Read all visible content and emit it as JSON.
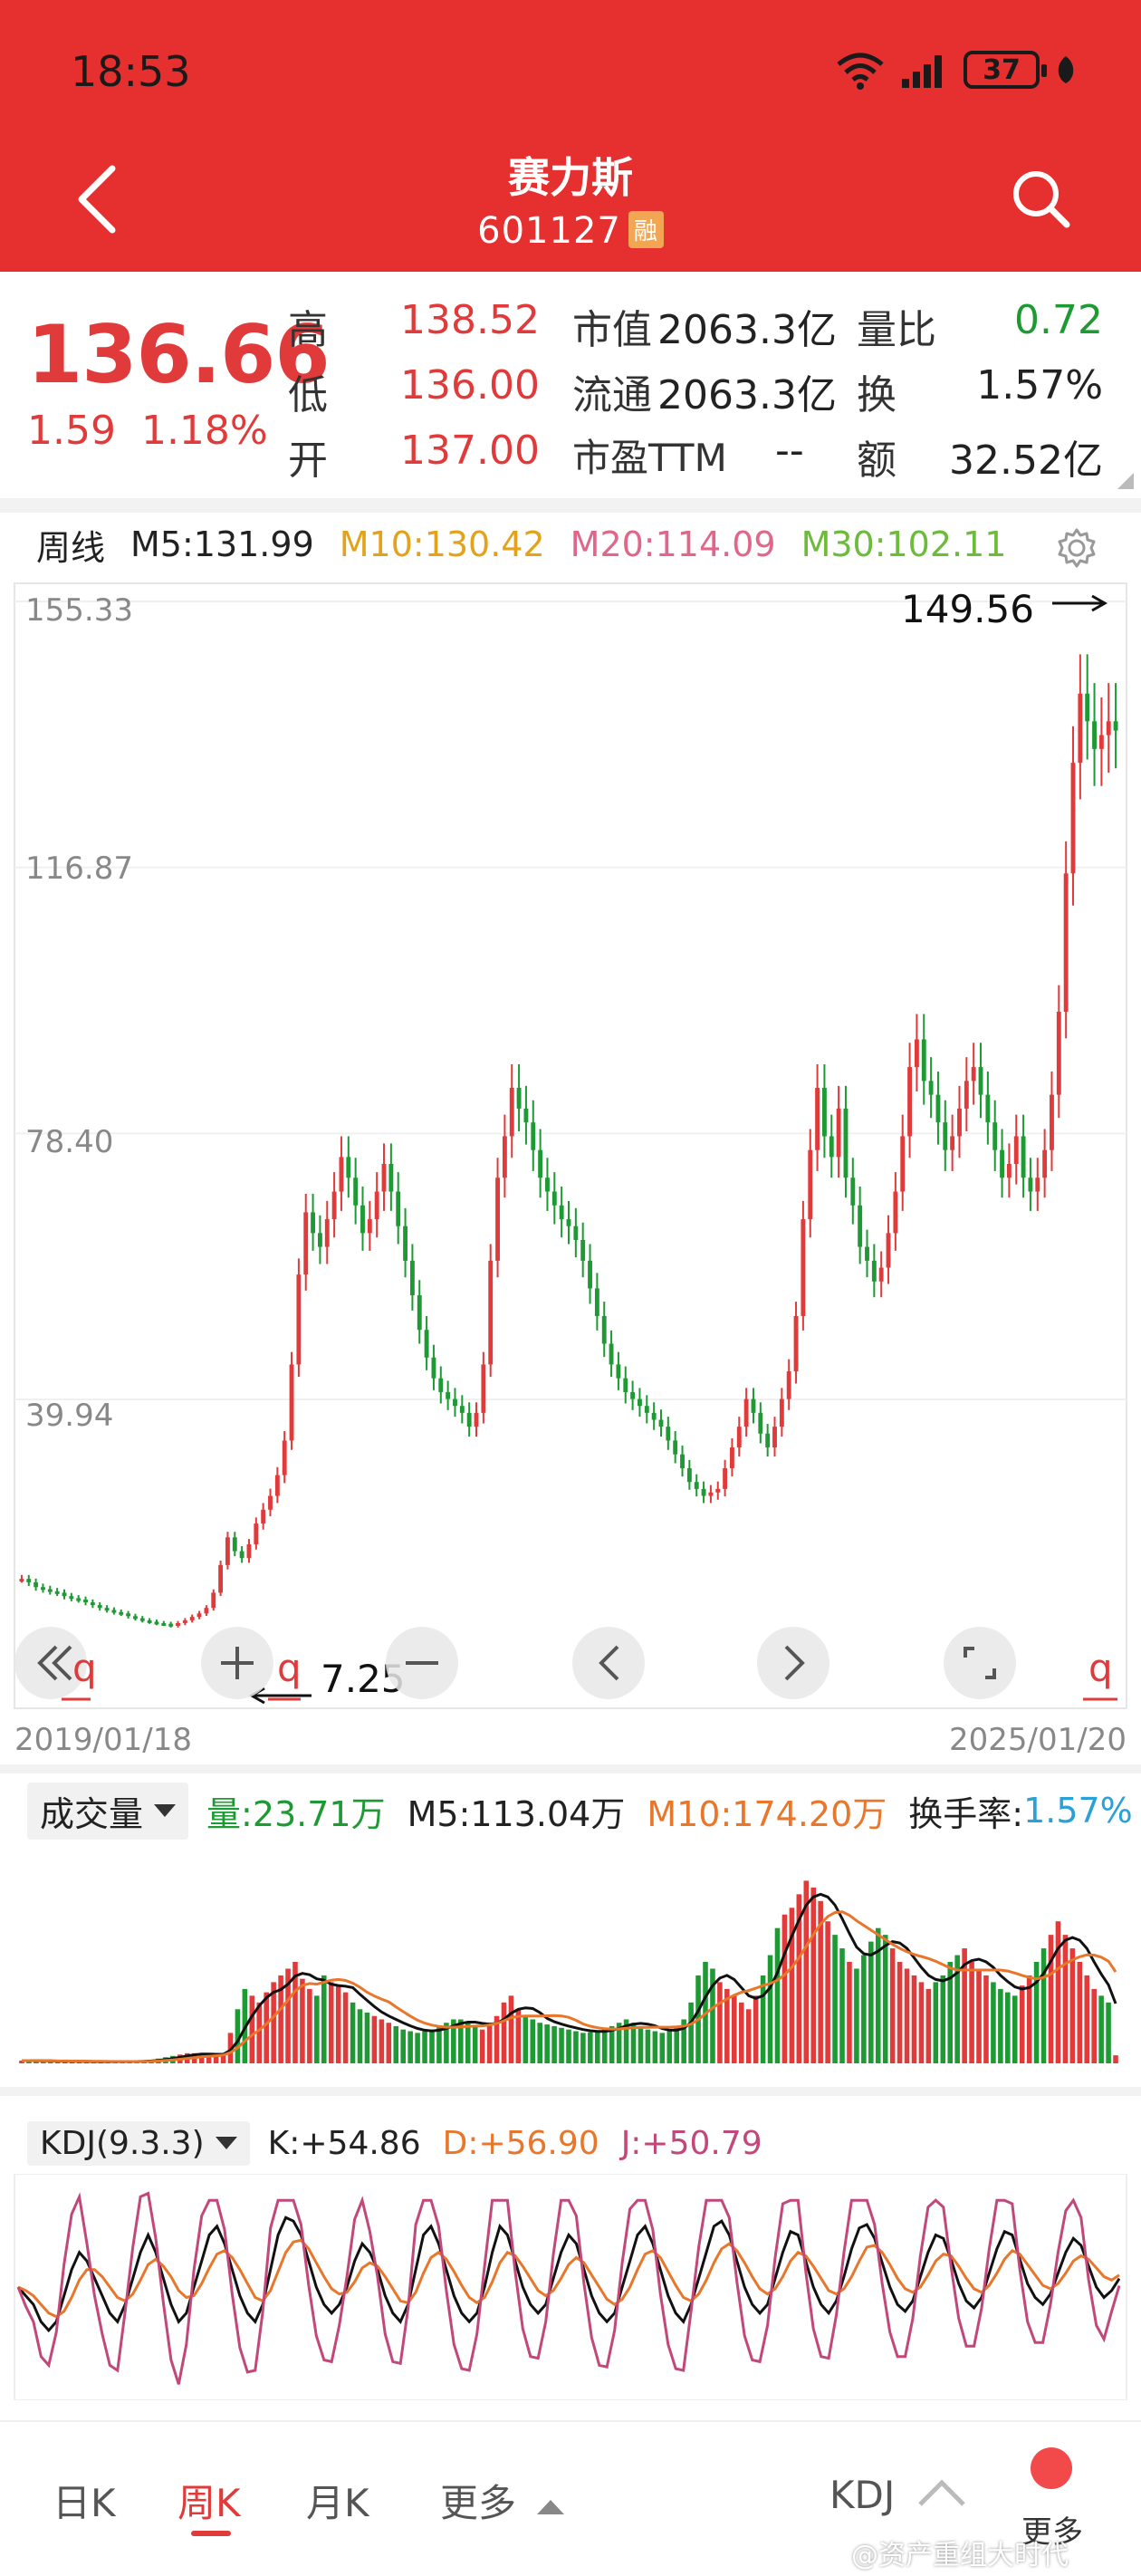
{
  "status": {
    "time": "18:53",
    "battery": "37"
  },
  "header": {
    "title": "赛力斯",
    "code": "601127",
    "badge": "融"
  },
  "quote": {
    "price": "136.66",
    "change": "1.59",
    "change_pct": "1.18%",
    "rows": [
      [
        "高",
        "138.52",
        "市值",
        "2063.3亿",
        "量比",
        "0.72"
      ],
      [
        "低",
        "136.00",
        "流通",
        "2063.3亿",
        "换",
        "1.57%"
      ],
      [
        "开",
        "137.00",
        "市盈TTM",
        "--",
        "额",
        "32.52亿"
      ]
    ]
  },
  "ma": {
    "period": "周线",
    "m5": "M5:131.99",
    "m10": "M10:130.42",
    "m20": "M20:114.09",
    "m30": "M30:102.11"
  },
  "price_chart": {
    "y_ticks": [
      "155.33",
      "116.87",
      "78.40",
      "39.94"
    ],
    "max_label": "149.56",
    "min_label": "7.25",
    "start_date": "2019/01/18",
    "end_date": "2025/01/20",
    "nav_q": "q"
  },
  "volume": {
    "selector": "成交量",
    "vol": "量:23.71万",
    "m5": "M5:113.04万",
    "m10": "M10:174.20万",
    "turnover_label": "换手率:",
    "turnover_value": "1.57%"
  },
  "kdj": {
    "selector": "KDJ(9.3.3)",
    "k": "K:+54.86",
    "d": "D:+56.90",
    "j": "J:+50.79"
  },
  "tabs": {
    "day": "日K",
    "week": "周K",
    "month": "月K",
    "more": "更多",
    "indicator": "KDJ",
    "more2": "更多"
  },
  "watermark": "@资产重组大时代",
  "colors": {
    "brand_red": "#e5302f",
    "up": "#e03a3a",
    "down": "#1d9a33",
    "m10": "#e3a21a",
    "m20": "#e0678a",
    "m30": "#6dbb3a"
  },
  "chart_data": [
    {
      "type": "candlestick",
      "title": "",
      "xlabel": "",
      "ylabel": "",
      "x_range": [
        "2019/01/18",
        "2025/01/20"
      ],
      "ylim": [
        0.0,
        155.33
      ],
      "y_ticks": [
        155.33,
        116.87,
        78.4,
        39.94
      ],
      "series": [
        {
          "name": "close",
          "values": [
            14,
            13.5,
            12.8,
            12.5,
            12.2,
            12,
            11.5,
            11.2,
            11,
            10.6,
            10.2,
            9.8,
            9.5,
            9.2,
            9,
            8.6,
            8.3,
            8,
            7.8,
            7.6,
            7.5,
            7.25,
            7.6,
            8,
            8.5,
            9,
            9.8,
            12,
            16,
            20,
            18,
            17,
            19,
            22,
            24,
            26,
            29,
            34,
            45,
            58,
            67,
            64,
            62,
            66,
            70,
            75,
            72,
            68,
            64,
            66,
            70,
            74,
            70,
            65,
            60,
            55,
            50,
            46,
            43,
            41,
            40,
            39,
            38,
            36,
            38,
            45,
            60,
            72,
            78,
            85,
            82,
            80,
            76,
            72,
            70,
            68,
            66,
            65,
            63,
            60,
            56,
            52,
            48,
            45,
            43,
            41,
            40,
            39,
            38,
            37,
            36,
            34,
            32,
            30,
            28,
            27,
            26,
            26.5,
            27,
            30,
            33,
            36,
            40,
            38,
            35,
            33,
            36,
            40,
            44,
            52,
            66,
            76,
            85,
            78,
            75,
            82,
            72,
            68,
            62,
            60,
            57,
            59,
            64,
            70,
            78,
            88,
            92,
            86,
            84,
            80,
            76,
            78,
            82,
            86,
            88,
            84,
            80,
            76,
            72,
            74,
            78,
            72,
            70,
            72,
            76,
            84,
            96,
            116,
            132,
            142,
            138,
            134,
            136,
            138,
            136.66
          ]
        }
      ],
      "max_point": 149.56,
      "min_point": 7.25
    },
    {
      "type": "bar",
      "title": "",
      "xlabel": "",
      "ylabel": "",
      "x_range": [
        "2019/01/18",
        "2025/01/20"
      ],
      "ylim": [
        0,
        600
      ],
      "series": [
        {
          "name": "量",
          "values": [
            8,
            8,
            7,
            7,
            6,
            6,
            6,
            6,
            5,
            5,
            5,
            5,
            5,
            5,
            5,
            6,
            6,
            8,
            10,
            14,
            18,
            22,
            26,
            30,
            30,
            28,
            24,
            22,
            30,
            90,
            160,
            220,
            200,
            180,
            210,
            240,
            260,
            280,
            300,
            250,
            220,
            200,
            260,
            240,
            230,
            210,
            180,
            160,
            150,
            140,
            130,
            120,
            110,
            100,
            95,
            90,
            95,
            100,
            110,
            120,
            130,
            130,
            120,
            110,
            100,
            120,
            140,
            180,
            200,
            160,
            140,
            130,
            120,
            115,
            110,
            105,
            100,
            95,
            90,
            92,
            95,
            100,
            110,
            120,
            130,
            120,
            110,
            100,
            95,
            90,
            95,
            110,
            130,
            180,
            260,
            300,
            280,
            240,
            220,
            200,
            180,
            160,
            200,
            260,
            320,
            400,
            440,
            460,
            500,
            540,
            520,
            480,
            420,
            380,
            340,
            300,
            280,
            320,
            360,
            400,
            380,
            340,
            300,
            280,
            260,
            240,
            220,
            240,
            260,
            300,
            320,
            340,
            300,
            280,
            260,
            240,
            220,
            210,
            200,
            230,
            260,
            300,
            340,
            380,
            420,
            380,
            340,
            300,
            260,
            220,
            200,
            180,
            23.71
          ]
        }
      ]
    },
    {
      "type": "line",
      "title": "",
      "xlabel": "",
      "ylabel": "",
      "x_range": [
        "2019/01/18",
        "2025/01/20"
      ],
      "ylim": [
        -10,
        110
      ],
      "series": [
        {
          "name": "K",
          "values": [
            50,
            45,
            40,
            30,
            25,
            30,
            45,
            60,
            70,
            65,
            55,
            45,
            35,
            30,
            40,
            55,
            70,
            80,
            70,
            55,
            40,
            30,
            35,
            50,
            65,
            80,
            85,
            75,
            60,
            45,
            35,
            30,
            40,
            60,
            80,
            90,
            88,
            80,
            65,
            50,
            40,
            35,
            40,
            50,
            65,
            75,
            70,
            60,
            45,
            35,
            30,
            40,
            60,
            80,
            85,
            75,
            60,
            45,
            35,
            30,
            35,
            50,
            70,
            85,
            80,
            65,
            50,
            40,
            35,
            40,
            55,
            70,
            80,
            75,
            60,
            45,
            35,
            30,
            35,
            50,
            65,
            80,
            85,
            75,
            60,
            45,
            35,
            30,
            40,
            55,
            70,
            85,
            88,
            80,
            65,
            50,
            40,
            35,
            40,
            55,
            70,
            82,
            80,
            65,
            50,
            40,
            35,
            42,
            56,
            72,
            84,
            86,
            78,
            64,
            50,
            40,
            36,
            42,
            56,
            70,
            80,
            78,
            66,
            52,
            42,
            38,
            44,
            58,
            72,
            82,
            80,
            66,
            52,
            44,
            40,
            46,
            58,
            70,
            78,
            74,
            62,
            50,
            44,
            48,
            54.86
          ]
        },
        {
          "name": "D",
          "values": [
            50,
            48,
            45,
            40,
            35,
            33,
            36,
            44,
            54,
            60,
            60,
            56,
            50,
            44,
            42,
            46,
            54,
            63,
            66,
            62,
            56,
            48,
            44,
            45,
            52,
            61,
            69,
            71,
            67,
            60,
            52,
            44,
            42,
            48,
            59,
            70,
            76,
            77,
            72,
            64,
            56,
            49,
            46,
            47,
            53,
            61,
            64,
            62,
            56,
            49,
            42,
            41,
            47,
            58,
            67,
            70,
            66,
            59,
            51,
            44,
            41,
            44,
            53,
            64,
            70,
            68,
            62,
            55,
            48,
            45,
            48,
            55,
            63,
            67,
            64,
            57,
            50,
            43,
            40,
            43,
            50,
            60,
            69,
            71,
            67,
            59,
            51,
            44,
            42,
            46,
            54,
            64,
            72,
            75,
            71,
            64,
            56,
            49,
            46,
            49,
            56,
            65,
            70,
            68,
            62,
            55,
            48,
            46,
            49,
            56,
            65,
            73,
            74,
            70,
            63,
            55,
            49,
            47,
            50,
            57,
            65,
            69,
            68,
            62,
            55,
            49,
            47,
            51,
            58,
            66,
            71,
            69,
            63,
            57,
            51,
            49,
            52,
            58,
            65,
            68,
            66,
            61,
            56,
            54,
            56.9
          ]
        },
        {
          "name": "J",
          "values": [
            50,
            39,
            30,
            10,
            5,
            24,
            63,
            92,
            102,
            75,
            45,
            23,
            5,
            2,
            36,
            73,
            102,
            104,
            78,
            41,
            8,
            -6,
            17,
            60,
            91,
            100,
            100,
            83,
            46,
            15,
            1,
            2,
            36,
            84,
            100,
            100,
            100,
            86,
            51,
            22,
            8,
            7,
            28,
            56,
            89,
            100,
            82,
            56,
            23,
            7,
            6,
            38,
            86,
            100,
            100,
            85,
            48,
            17,
            3,
            2,
            23,
            62,
            100,
            100,
            100,
            59,
            26,
            10,
            9,
            30,
            69,
            100,
            100,
            91,
            52,
            21,
            5,
            4,
            25,
            64,
            95,
            100,
            100,
            83,
            46,
            17,
            3,
            2,
            36,
            73,
            100,
            100,
            100,
            90,
            53,
            22,
            8,
            7,
            28,
            67,
            98,
            100,
            100,
            59,
            26,
            10,
            9,
            34,
            70,
            100,
            100,
            100,
            86,
            52,
            24,
            10,
            10,
            32,
            68,
            96,
            100,
            96,
            62,
            32,
            16,
            16,
            38,
            72,
            100,
            100,
            98,
            60,
            30,
            18,
            18,
            40,
            70,
            94,
            100,
            90,
            54,
            28,
            20,
            36,
            50.79
          ]
        }
      ]
    }
  ]
}
